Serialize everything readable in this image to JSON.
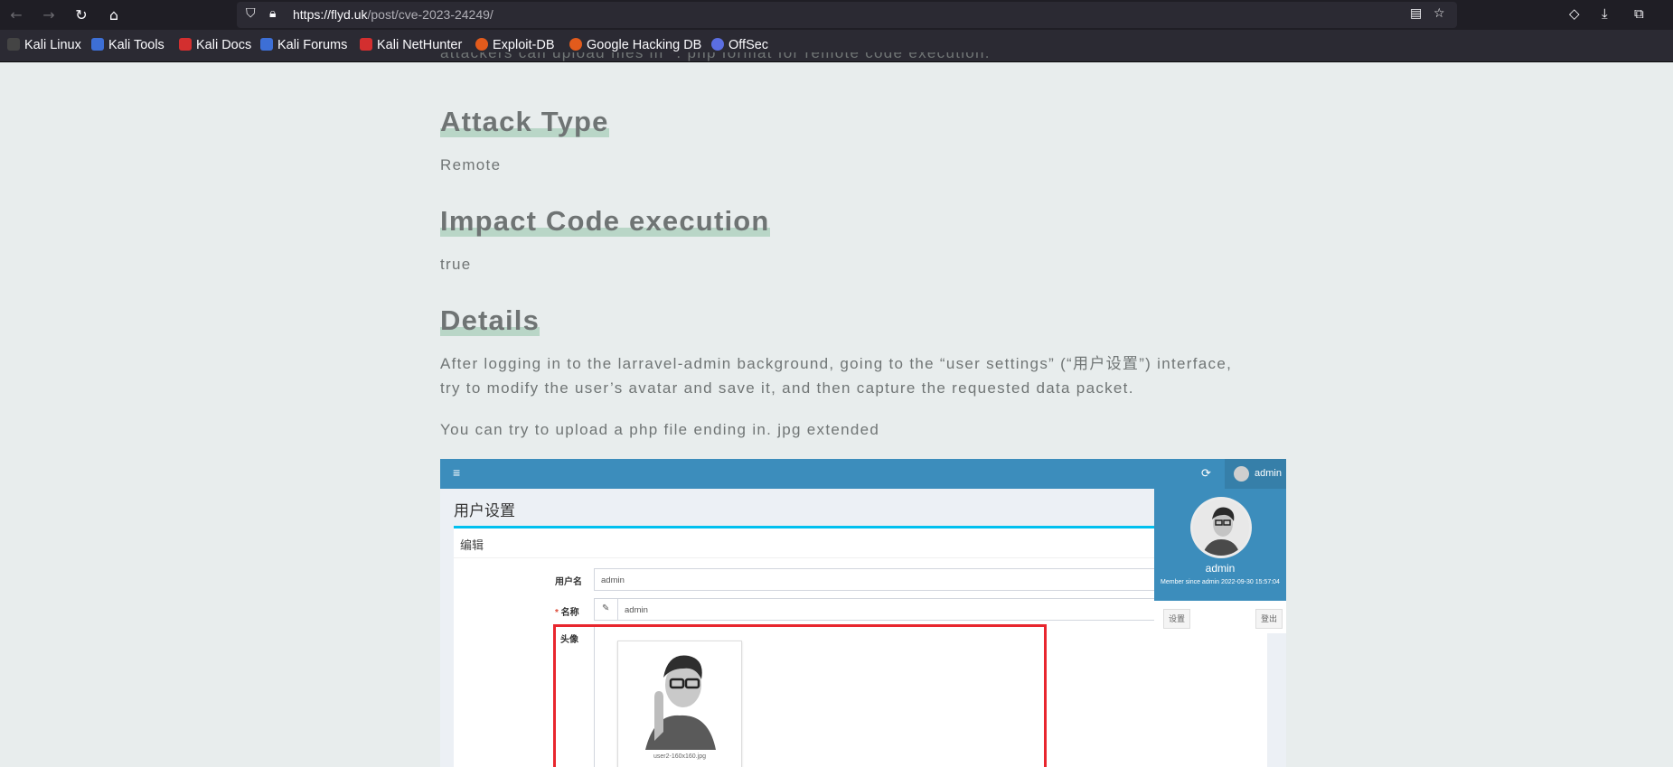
{
  "browser": {
    "url_domain": "https://flyd.uk",
    "url_path": "/post/cve-2023-24249/",
    "bookmarks": [
      {
        "label": "Kali Linux",
        "color": "#2b2b2b"
      },
      {
        "label": "Kali Tools",
        "color": "#3d6fd6"
      },
      {
        "label": "Kali Docs",
        "color": "#d32f2f"
      },
      {
        "label": "Kali Forums",
        "color": "#3d6fd6"
      },
      {
        "label": "Kali NetHunter",
        "color": "#d32f2f"
      },
      {
        "label": "Exploit-DB",
        "color": "#e25b1c"
      },
      {
        "label": "Google Hacking DB",
        "color": "#e25b1c"
      },
      {
        "label": "OffSec",
        "color": "#5b6ee1"
      }
    ]
  },
  "article": {
    "top_partial": "attackers can upload files in *. php format for remote code execution.",
    "h_attack_type": "Attack Type",
    "attack_type_value": "Remote",
    "h_impact": "Impact Code execution",
    "impact_value": "true",
    "h_details": "Details",
    "details_line1": "After logging in to the larravel-admin background, going to the “user settings” (“用户设置”) interface,",
    "details_line2": "try to modify the user’s avatar and save it, and then capture the requested data packet.",
    "details_para2": "You can try to upload a php file ending in. jpg extended"
  },
  "screenshot": {
    "topbar_user": "admin",
    "page_title": "用户设置",
    "panel_title": "编辑",
    "label_username": "用户名",
    "username_value": "admin",
    "label_name": "名称",
    "name_value": "admin",
    "label_avatar": "头像",
    "avatar_caption": "user2-160x160.jpg",
    "dropdown_name": "admin",
    "dropdown_since": "Member since admin 2022-09-30 15:57:04",
    "btn_settings": "设置",
    "btn_logout": "登出",
    "colors": {
      "header": "#3c8dbc",
      "highlight_box": "#e8262e"
    }
  }
}
